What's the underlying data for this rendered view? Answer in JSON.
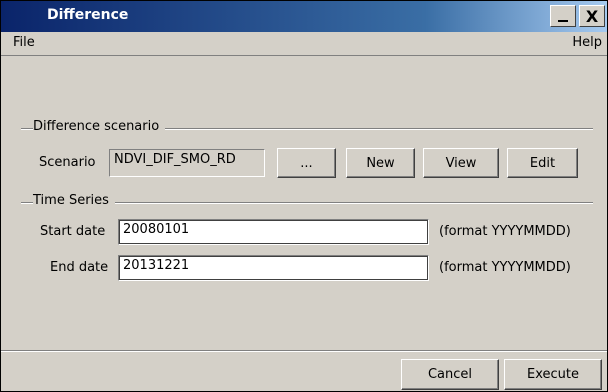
{
  "window": {
    "title": "Difference"
  },
  "titlebar_buttons": {
    "minimize_icon": "minimize-icon",
    "close_glyph": "X"
  },
  "menu": {
    "file": "File",
    "help": "Help"
  },
  "difference_scenario": {
    "group_label": "Difference scenario",
    "scenario_label": "Scenario",
    "scenario_value": "NDVI_DIF_SMO_RD",
    "browse_button": "...",
    "new_button": "New",
    "view_button": "View",
    "edit_button": "Edit"
  },
  "time_series": {
    "group_label": "Time Series",
    "start_label": "Start date",
    "start_value": "20080101",
    "start_hint": "(format YYYYMMDD)",
    "end_label": "End date",
    "end_value": "20131221",
    "end_hint": "(format YYYYMMDD)"
  },
  "footer": {
    "cancel_button": "Cancel",
    "execute_button": "Execute"
  }
}
